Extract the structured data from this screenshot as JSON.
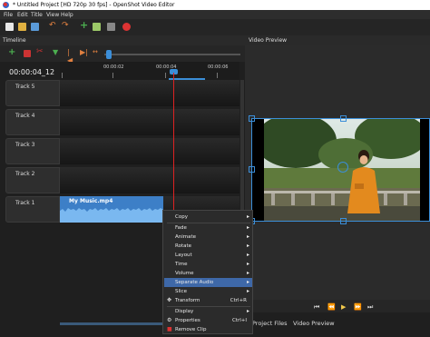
{
  "window": {
    "title": "* Untitled Project [HD 720p 30 fps] - OpenShot Video Editor"
  },
  "menubar": [
    "File",
    "Edit",
    "Title",
    "View",
    "Help"
  ],
  "timeline": {
    "header": "Timeline",
    "timecode": "00:00:04_12",
    "ruler_labels": [
      "00:00:02",
      "00:00:04",
      "00:00:06"
    ],
    "tracks": [
      "Track 5",
      "Track 4",
      "Track 3",
      "Track 2",
      "Track 1"
    ],
    "clip": {
      "name": "My Music.mp4"
    }
  },
  "preview": {
    "header": "Video Preview",
    "tabs": [
      "Project Files",
      "Video Preview"
    ]
  },
  "context_menu": [
    {
      "label": "Copy",
      "submenu": true
    },
    {
      "label": "Fade",
      "submenu": true
    },
    {
      "label": "Animate",
      "submenu": true
    },
    {
      "label": "Rotate",
      "submenu": true
    },
    {
      "label": "Layout",
      "submenu": true
    },
    {
      "label": "Time",
      "submenu": true
    },
    {
      "label": "Volume",
      "submenu": true
    },
    {
      "label": "Separate Audio",
      "submenu": true,
      "selected": true
    },
    {
      "label": "Slice",
      "submenu": true
    },
    {
      "label": "Transform",
      "shortcut": "Ctrl+R"
    },
    {
      "label": "Display",
      "submenu": true
    },
    {
      "label": "Properties",
      "shortcut": "Ctrl+I"
    },
    {
      "label": "Remove Clip"
    }
  ],
  "colors": {
    "accent": "#3b8ed8",
    "clip": "#3d7fc7",
    "playhead": "#dd2222",
    "selection": "#3e68a8"
  }
}
